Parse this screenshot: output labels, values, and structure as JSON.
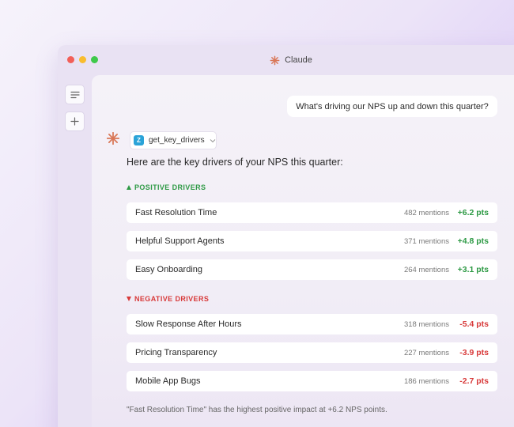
{
  "window": {
    "title": "Claude"
  },
  "colors": {
    "accent": "#d97757",
    "positive": "#2e9a45",
    "negative": "#d83a3a",
    "tool": "#2aa3d8"
  },
  "sidebar": {
    "items": [
      {
        "icon": "menu-icon"
      },
      {
        "icon": "plus-icon"
      }
    ]
  },
  "chat": {
    "user_message": "What's driving our NPS up and down this quarter?",
    "tool_call": {
      "name": "get_key_drivers",
      "logo_text": "Z",
      "icon": "chevron-down-icon"
    },
    "intro": "Here are the key drivers of your NPS this quarter:",
    "positive": {
      "heading": "POSITIVE DRIVERS",
      "items": [
        {
          "label": "Fast Resolution Time",
          "mentions": "482 mentions",
          "delta": "+6.2 pts"
        },
        {
          "label": "Helpful Support Agents",
          "mentions": "371 mentions",
          "delta": "+4.8 pts"
        },
        {
          "label": "Easy Onboarding",
          "mentions": "264 mentions",
          "delta": "+3.1 pts"
        }
      ]
    },
    "negative": {
      "heading": "NEGATIVE DRIVERS",
      "items": [
        {
          "label": "Slow Response After Hours",
          "mentions": "318 mentions",
          "delta": "-5.4 pts"
        },
        {
          "label": "Pricing Transparency",
          "mentions": "227 mentions",
          "delta": "-3.9 pts"
        },
        {
          "label": "Mobile App Bugs",
          "mentions": "186 mentions",
          "delta": "-2.7 pts"
        }
      ]
    },
    "footnote": "\"Fast Resolution Time\" has the highest positive impact at +6.2 NPS points."
  }
}
